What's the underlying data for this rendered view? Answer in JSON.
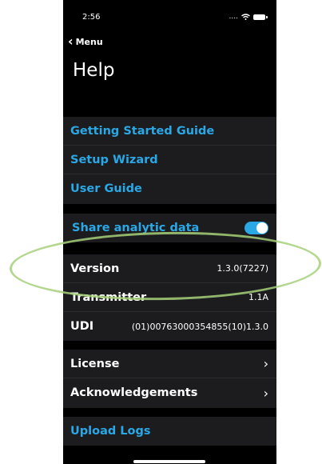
{
  "status": {
    "time": "2:56",
    "signal": "....",
    "wifi": "wifi-icon",
    "battery": "battery-icon"
  },
  "nav": {
    "back_label": "Menu",
    "title": "Help"
  },
  "help_links": [
    "Getting Started Guide",
    "Setup Wizard",
    "User Guide"
  ],
  "analytics": {
    "label": "Share analytic data",
    "enabled": true
  },
  "info": {
    "version": {
      "label": "Version",
      "value": "1.3.0(7227)"
    },
    "transmitter": {
      "label": "Transmitter",
      "value": "1.1A"
    },
    "udi": {
      "label": "UDI",
      "value": "(01)00763000354855(10)1.3.0"
    }
  },
  "legal": [
    "License",
    "Acknowledgements"
  ],
  "upload_logs": "Upload Logs",
  "colors": {
    "accent": "#2aa8e6",
    "annotation": "#a7d07a",
    "cell_bg": "#1c1c1e"
  }
}
